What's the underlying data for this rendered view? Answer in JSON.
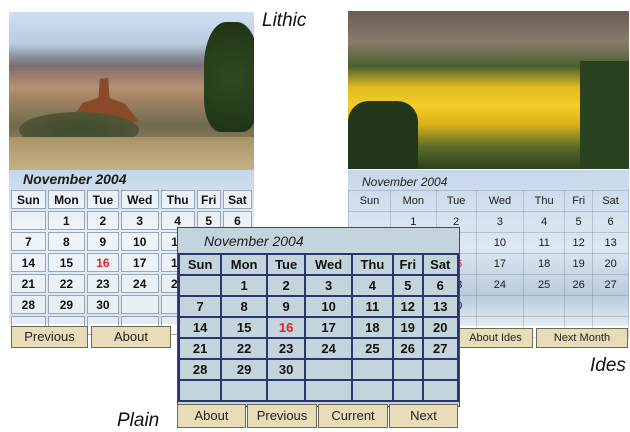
{
  "captions": {
    "lithic": "Lithic",
    "ides": "Ides",
    "plain": "Plain"
  },
  "month_title": "November 2004",
  "weekdays": [
    "Sun",
    "Mon",
    "Tue",
    "Wed",
    "Thu",
    "Fri",
    "Sat"
  ],
  "weeks": [
    [
      "",
      "1",
      "2",
      "3",
      "4",
      "5",
      "6"
    ],
    [
      "7",
      "8",
      "9",
      "10",
      "11",
      "12",
      "13"
    ],
    [
      "14",
      "15",
      "16",
      "17",
      "18",
      "19",
      "20"
    ],
    [
      "21",
      "22",
      "23",
      "24",
      "25",
      "26",
      "27"
    ],
    [
      "28",
      "29",
      "30",
      "",
      "",
      "",
      ""
    ],
    [
      "",
      "",
      "",
      "",
      "",
      "",
      ""
    ]
  ],
  "today": "16",
  "lithic_nav": {
    "previous": "Previous",
    "about": "About"
  },
  "ides_nav": {
    "about": "About Ides",
    "next": "Next Month"
  },
  "plain_nav": {
    "about": "About",
    "previous": "Previous",
    "current": "Current",
    "next": "Next"
  },
  "colors": {
    "today": "#e3232a",
    "button_bg": "#e9dcb8",
    "plain_grid": "#2a3570"
  }
}
